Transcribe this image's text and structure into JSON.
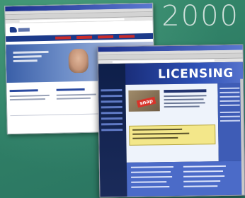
{
  "slide": {
    "year_label": "2000",
    "background_color": "#2f7f66"
  },
  "window_usps": {
    "brand_color": "#1c3a8a",
    "accent_color": "#c92b2b",
    "icon": "eagle-icon"
  },
  "window_licensing": {
    "header_title": "LICENSING",
    "photo_tag": "snap",
    "header_color": "#2c4fb5",
    "highlight_color": "#f3e78a"
  }
}
